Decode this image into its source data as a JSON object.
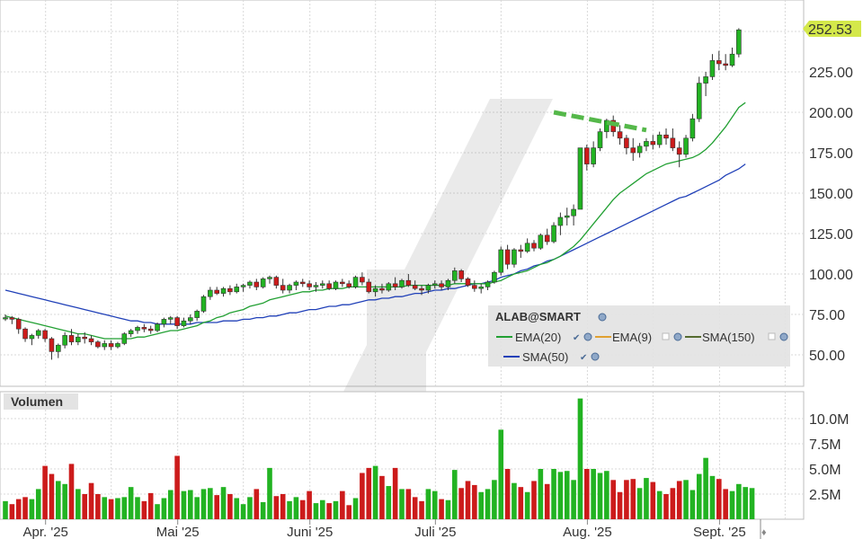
{
  "symbol": "ALAB@SMART",
  "last_price": "252.53",
  "last_price_value": 252.53,
  "colors": {
    "up": "#22b322",
    "down": "#cc1b1b",
    "ema20": "#22a033",
    "sma50": "#2040b8",
    "ema9": "#e0a030",
    "sma150": "#556b2f",
    "grid": "#d8d8d8",
    "price_tag": "#d4e84a"
  },
  "legend": {
    "title": "ALAB@SMART",
    "items": [
      {
        "label": "EMA(20)"
      },
      {
        "label": "EMA(9)"
      },
      {
        "label": "SMA(150)"
      },
      {
        "label": "SMA(50)"
      }
    ]
  },
  "volume_title": "Volumen",
  "chart_data": [
    {
      "type": "candlestick",
      "title": "",
      "y_ticks": [
        "50.00",
        "75.00",
        "100.00",
        "125.00",
        "150.00",
        "175.00",
        "200.00",
        "225.00",
        "250.00"
      ],
      "y_tick_values": [
        50,
        75,
        100,
        125,
        150,
        175,
        200,
        225,
        250
      ],
      "ylim": [
        27,
        258
      ],
      "x_tick_labels": [
        "Apr. '25",
        "Mai '25",
        "Juni '25",
        "Juli '25",
        "Aug. '25",
        "Sept. '25"
      ],
      "x_tick_index": [
        2,
        22,
        42,
        61,
        84,
        104
      ],
      "grid": true,
      "candles_ohlc": [
        [
          73,
          75,
          71,
          73
        ],
        [
          73,
          74,
          69,
          72
        ],
        [
          72,
          73,
          63,
          66
        ],
        [
          66,
          67,
          58,
          60
        ],
        [
          60,
          63,
          56,
          62
        ],
        [
          62,
          66,
          60,
          65
        ],
        [
          65,
          66,
          58,
          60
        ],
        [
          60,
          61,
          47,
          52
        ],
        [
          52,
          57,
          48,
          56
        ],
        [
          56,
          64,
          54,
          62
        ],
        [
          62,
          66,
          56,
          58
        ],
        [
          58,
          63,
          56,
          61
        ],
        [
          61,
          64,
          57,
          60
        ],
        [
          60,
          62,
          56,
          58
        ],
        [
          58,
          59,
          54,
          55
        ],
        [
          55,
          59,
          53,
          57
        ],
        [
          57,
          59,
          53,
          55
        ],
        [
          55,
          58,
          54,
          57
        ],
        [
          57,
          64,
          56,
          63
        ],
        [
          63,
          66,
          61,
          65
        ],
        [
          65,
          68,
          63,
          67
        ],
        [
          67,
          69,
          64,
          66
        ],
        [
          66,
          68,
          63,
          65
        ],
        [
          65,
          70,
          64,
          69
        ],
        [
          69,
          73,
          67,
          72
        ],
        [
          72,
          74,
          69,
          73
        ],
        [
          73,
          74,
          66,
          68
        ],
        [
          68,
          73,
          67,
          71
        ],
        [
          71,
          75,
          69,
          73
        ],
        [
          73,
          78,
          71,
          77
        ],
        [
          77,
          87,
          76,
          86
        ],
        [
          86,
          92,
          84,
          90
        ],
        [
          90,
          92,
          87,
          88
        ],
        [
          88,
          92,
          86,
          91
        ],
        [
          91,
          93,
          87,
          89
        ],
        [
          89,
          94,
          88,
          92
        ],
        [
          92,
          94,
          89,
          93
        ],
        [
          93,
          96,
          91,
          95
        ],
        [
          95,
          97,
          90,
          92
        ],
        [
          92,
          98,
          91,
          97
        ],
        [
          97,
          99,
          94,
          98
        ],
        [
          98,
          99,
          91,
          93
        ],
        [
          93,
          97,
          88,
          90
        ],
        [
          90,
          94,
          88,
          93
        ],
        [
          93,
          96,
          90,
          95
        ],
        [
          95,
          97,
          92,
          94
        ],
        [
          94,
          96,
          90,
          92
        ],
        [
          92,
          95,
          89,
          93
        ],
        [
          93,
          96,
          91,
          94
        ],
        [
          94,
          96,
          90,
          91
        ],
        [
          91,
          96,
          90,
          95
        ],
        [
          95,
          97,
          92,
          94
        ],
        [
          94,
          96,
          91,
          92
        ],
        [
          92,
          99,
          91,
          98
        ],
        [
          98,
          101,
          93,
          95
        ],
        [
          95,
          97,
          88,
          89
        ],
        [
          89,
          93,
          86,
          91
        ],
        [
          91,
          94,
          88,
          90
        ],
        [
          90,
          95,
          89,
          94
        ],
        [
          94,
          98,
          90,
          92
        ],
        [
          92,
          97,
          91,
          96
        ],
        [
          96,
          100,
          92,
          93
        ],
        [
          93,
          96,
          90,
          91
        ],
        [
          91,
          93,
          87,
          90
        ],
        [
          90,
          94,
          88,
          93
        ],
        [
          93,
          96,
          91,
          94
        ],
        [
          94,
          96,
          90,
          92
        ],
        [
          92,
          97,
          90,
          96
        ],
        [
          96,
          104,
          94,
          102
        ],
        [
          102,
          103,
          95,
          97
        ],
        [
          97,
          98,
          92,
          93
        ],
        [
          93,
          96,
          89,
          91
        ],
        [
          91,
          94,
          88,
          92
        ],
        [
          92,
          96,
          90,
          95
        ],
        [
          95,
          102,
          94,
          101
        ],
        [
          101,
          117,
          99,
          115
        ],
        [
          115,
          118,
          103,
          106
        ],
        [
          106,
          116,
          104,
          115
        ],
        [
          115,
          118,
          110,
          114
        ],
        [
          114,
          122,
          113,
          119
        ],
        [
          119,
          121,
          114,
          116
        ],
        [
          116,
          125,
          115,
          124
        ],
        [
          124,
          128,
          118,
          120
        ],
        [
          120,
          132,
          119,
          130
        ],
        [
          130,
          138,
          124,
          135
        ],
        [
          135,
          141,
          130,
          136
        ],
        [
          136,
          143,
          130,
          140
        ],
        [
          140,
          170,
          160,
          178
        ],
        [
          178,
          180,
          164,
          168
        ],
        [
          168,
          182,
          166,
          178
        ],
        [
          178,
          190,
          176,
          188
        ],
        [
          188,
          196,
          184,
          195
        ],
        [
          195,
          198,
          185,
          188
        ],
        [
          188,
          192,
          180,
          184
        ],
        [
          184,
          186,
          174,
          178
        ],
        [
          178,
          184,
          170,
          175
        ],
        [
          175,
          181,
          172,
          179
        ],
        [
          179,
          184,
          176,
          182
        ],
        [
          182,
          186,
          177,
          180
        ],
        [
          180,
          188,
          178,
          186
        ],
        [
          186,
          190,
          180,
          184
        ],
        [
          184,
          190,
          176,
          178
        ],
        [
          178,
          182,
          166,
          174
        ],
        [
          174,
          186,
          172,
          184
        ],
        [
          184,
          199,
          182,
          196
        ],
        [
          196,
          222,
          194,
          218
        ],
        [
          218,
          225,
          210,
          222
        ],
        [
          222,
          236,
          220,
          232
        ],
        [
          232,
          238,
          226,
          230
        ],
        [
          230,
          236,
          226,
          229
        ],
        [
          229,
          240,
          228,
          236
        ],
        [
          236,
          252,
          234,
          251
        ]
      ],
      "volume_ticks": [
        "2.5M",
        "5.0M",
        "7.5M",
        "10.0M"
      ],
      "volume_tick_values": [
        2.5,
        5.0,
        7.5,
        10.0
      ],
      "volume_ylim": [
        0,
        12.5
      ],
      "volumes_m": [
        1.8,
        1.5,
        2.0,
        2.2,
        2.0,
        3.0,
        5.3,
        4.5,
        3.8,
        3.5,
        5.5,
        3.0,
        2.5,
        3.6,
        2.5,
        2.2,
        2.0,
        2.1,
        2.2,
        3.2,
        2.2,
        1.8,
        2.6,
        1.5,
        2.1,
        2.9,
        6.3,
        2.8,
        2.9,
        2.2,
        3.0,
        3.1,
        2.4,
        3.2,
        2.5,
        2.1,
        1.5,
        2.2,
        3.0,
        1.7,
        5.1,
        2.3,
        2.5,
        1.8,
        2.2,
        1.9,
        2.8,
        1.6,
        1.9,
        1.6,
        1.8,
        2.8,
        1.4,
        2.1,
        4.6,
        5.1,
        5.3,
        4.3,
        3.3,
        5.1,
        3.0,
        3.0,
        2.2,
        1.8,
        3.0,
        2.8,
        2.0,
        1.9,
        4.9,
        3.1,
        3.8,
        3.4,
        2.7,
        3.0,
        3.9,
        8.9,
        5.0,
        3.6,
        3.2,
        2.7,
        3.8,
        5.0,
        3.5,
        5.0,
        4.7,
        4.8,
        3.9,
        12.0,
        5.0,
        5.0,
        4.6,
        4.8,
        3.9,
        2.7,
        3.9,
        4.0,
        3.1,
        4.1,
        3.7,
        2.8,
        2.5,
        3.1,
        3.8,
        3.9,
        2.9,
        4.5,
        6.1,
        4.3,
        4.0,
        3.0,
        2.8,
        3.5,
        3.2,
        3.1
      ],
      "series": [
        {
          "name": "EMA(20)",
          "values": [
            74,
            73,
            72,
            71,
            70,
            69,
            68,
            67,
            66,
            65,
            64,
            63,
            63,
            62,
            61,
            60,
            60,
            60,
            60,
            60,
            61,
            61,
            62,
            63,
            64,
            65,
            65,
            66,
            67,
            68,
            70,
            71,
            73,
            74,
            76,
            77,
            78,
            80,
            81,
            82,
            84,
            85,
            86,
            87,
            88,
            89,
            89,
            90,
            90,
            91,
            91,
            91,
            92,
            92,
            92,
            92,
            92,
            92,
            92,
            92,
            92,
            93,
            93,
            93,
            93,
            93,
            93,
            93,
            94,
            94,
            94,
            94,
            94,
            94,
            95,
            96,
            98,
            100,
            101,
            102,
            104,
            106,
            107,
            109,
            111,
            114,
            117,
            121,
            126,
            131,
            136,
            141,
            146,
            150,
            153,
            156,
            159,
            162,
            164,
            166,
            168,
            169,
            170,
            171,
            172,
            174,
            177,
            181,
            186,
            191,
            197,
            203,
            206
          ]
        },
        {
          "name": "SMA(50)",
          "values": [
            90,
            89,
            88,
            87,
            86,
            85,
            84,
            83,
            82,
            81,
            80,
            79,
            78,
            77,
            76,
            75,
            74,
            73,
            72,
            71,
            71,
            70,
            70,
            69,
            69,
            69,
            69,
            69,
            69,
            70,
            70,
            70,
            70,
            71,
            71,
            71,
            72,
            72,
            73,
            73,
            74,
            74,
            75,
            76,
            76,
            77,
            78,
            78,
            79,
            80,
            80,
            81,
            81,
            82,
            83,
            84,
            84,
            85,
            85,
            86,
            86,
            87,
            88,
            88,
            89,
            90,
            90,
            91,
            91,
            92,
            93,
            94,
            94,
            95,
            96,
            98,
            99,
            100,
            102,
            103,
            105,
            106,
            108,
            109,
            111,
            113,
            115,
            117,
            119,
            121,
            123,
            125,
            127,
            129,
            131,
            133,
            135,
            137,
            139,
            141,
            143,
            145,
            147,
            148,
            150,
            152,
            154,
            156,
            158,
            161,
            163,
            165,
            168
          ]
        }
      ],
      "trendline_dashed": {
        "from": [
          83,
          200
        ],
        "to": [
          97,
          189
        ]
      }
    }
  ]
}
